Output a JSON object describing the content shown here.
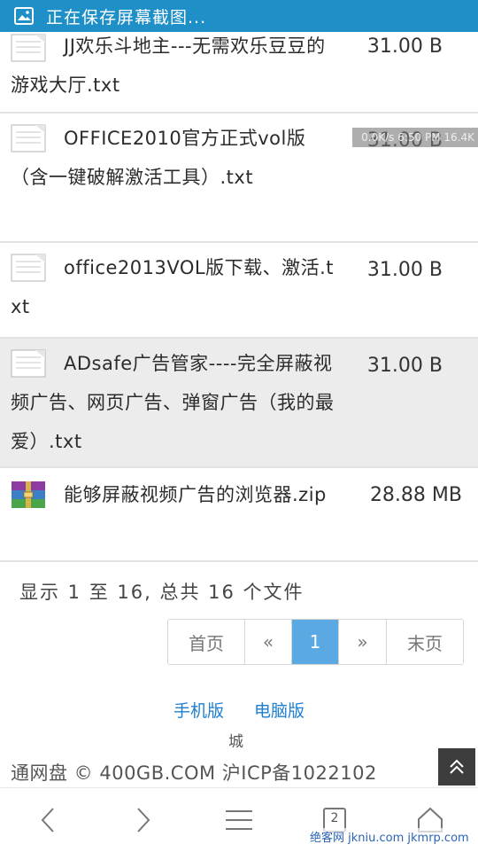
{
  "status_bar": {
    "text": "正在保存屏幕截图...",
    "icon": "image-icon",
    "color": "#1f8fc7"
  },
  "files": [
    {
      "name": "JJ欢乐斗地主---无需欢乐豆豆的游戏大厅.txt",
      "size": "31.00 B",
      "icon": "text-file-icon",
      "highlighted": false
    },
    {
      "name": "OFFICE2010官方正式vol版（含一键破解激活工具）.txt",
      "size": "31.00 B",
      "icon": "text-file-icon",
      "highlighted": false
    },
    {
      "name": "office2013VOL版下载、激活.txt",
      "size": "31.00 B",
      "icon": "text-file-icon",
      "highlighted": false
    },
    {
      "name": "ADsafe广告管家----完全屏蔽视频广告、网页广告、弹窗广告（我的最爱）.txt",
      "size": "31.00 B",
      "icon": "text-file-icon",
      "highlighted": true
    },
    {
      "name": "能够屏蔽视频广告的浏览器.zip",
      "size": "28.88 MB",
      "icon": "archive-icon",
      "highlighted": false
    }
  ],
  "overlay_badge": "0.0K/s 6:50 PM 16.4K",
  "summary": "显示 1 至 16, 总共 16 个文件",
  "pagination": {
    "first": "首页",
    "prev": "«",
    "current": "1",
    "next": "»",
    "last": "末页",
    "active_color": "#5aa9e2"
  },
  "footer": {
    "mobile_link": "手机版",
    "desktop_link": "电脑版",
    "small_text": "城",
    "copyright": "通网盘 © 400GB.COM  沪ICP备1022102",
    "link_color": "#1e7fd0"
  },
  "bottom_nav": {
    "tab_count": "2"
  },
  "watermark": "绝客网 jkniu.com jkmrp.com"
}
